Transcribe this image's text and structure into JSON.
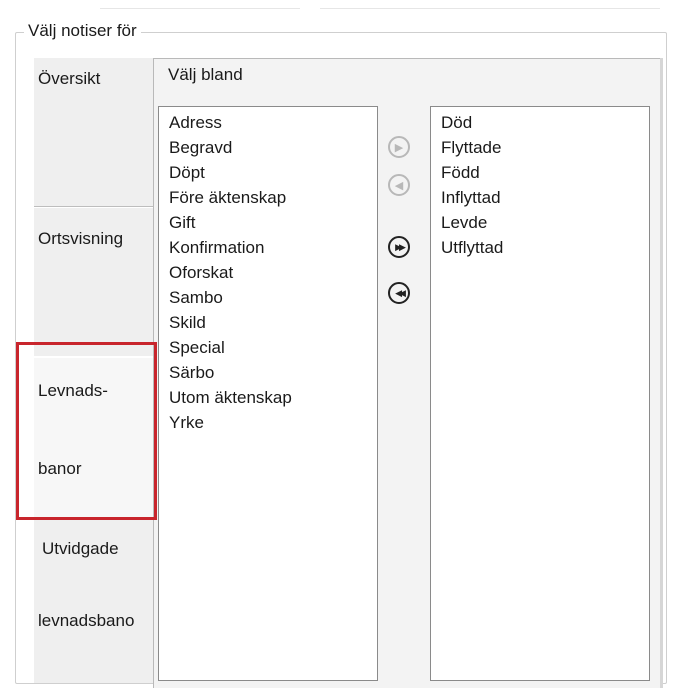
{
  "group": {
    "legend": "Välj notiser för"
  },
  "tabs": [
    {
      "label_lines": [
        "Översikt"
      ]
    },
    {
      "label_lines": [
        "Ortsvisning"
      ]
    },
    {
      "label_lines": [
        "Levnads-",
        "banor"
      ]
    },
    {
      "label_lines": [
        "Utvidgade",
        "levnadsbano"
      ]
    }
  ],
  "panel": {
    "title": "Välj bland"
  },
  "available_list": [
    "Adress",
    "Begravd",
    "Döpt",
    "Före äktenskap",
    "Gift",
    "Konfirmation",
    "Oforskat",
    "Sambo",
    "Skild",
    "Special",
    "Särbo",
    "Utom äktenskap",
    "Yrke"
  ],
  "selected_list": [
    "Död",
    "Flyttade",
    "Född",
    "Inflyttad",
    "Levde",
    "Utflyttad"
  ],
  "buttons": {
    "move_right_icon": "arrow-right-circle",
    "move_left_icon": "arrow-left-circle",
    "move_all_right_icon": "double-arrow-right-circle",
    "move_all_left_icon": "double-arrow-left-circle"
  },
  "colors": {
    "highlight": "#c8252c"
  }
}
